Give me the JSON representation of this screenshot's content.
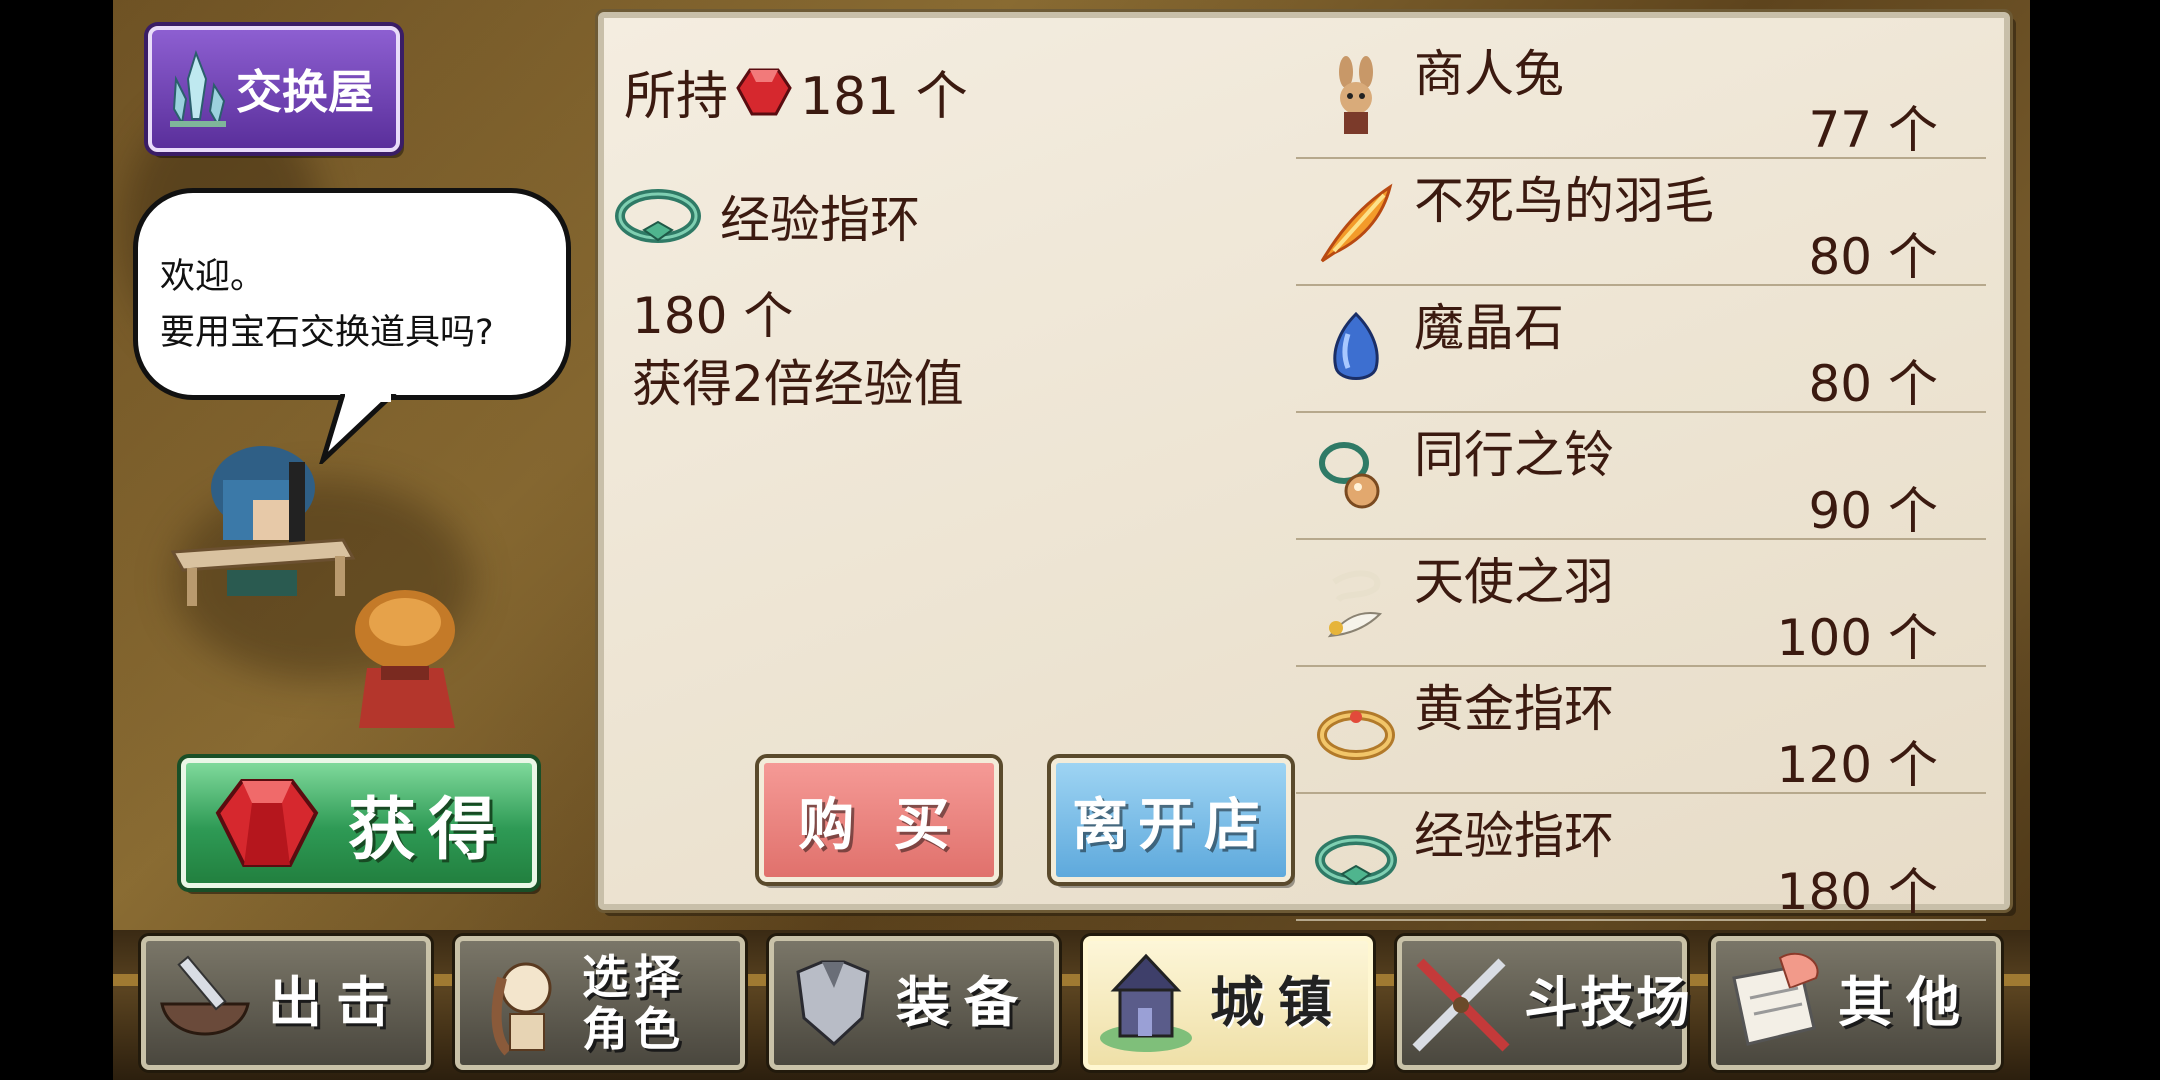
{
  "shop": {
    "title": "交换屋"
  },
  "speech": {
    "line1": "欢迎。",
    "line2": "要用宝石交换道具吗?"
  },
  "obtain_button": {
    "label": "获得"
  },
  "panel": {
    "owned_prefix": "所持",
    "owned_count": "181 个",
    "selected_item": {
      "name": "经验指环",
      "price": "180 个",
      "description": "获得2倍经验值"
    },
    "buy_label": "购 买",
    "leave_label": "离开店"
  },
  "items": [
    {
      "name": "商人兔",
      "price": "77 个",
      "icon": "rabbit-icon"
    },
    {
      "name": "不死鸟的羽毛",
      "price": "80 个",
      "icon": "phoenix-feather-icon"
    },
    {
      "name": "魔晶石",
      "price": "80 个",
      "icon": "blue-crystal-icon"
    },
    {
      "name": "同行之铃",
      "price": "90 个",
      "icon": "bell-icon"
    },
    {
      "name": "天使之羽",
      "price": "100 个",
      "icon": "angel-feather-icon"
    },
    {
      "name": "黄金指环",
      "price": "120 个",
      "icon": "gold-ring-icon"
    },
    {
      "name": "经验指环",
      "price": "180 个",
      "icon": "exp-ring-icon"
    }
  ],
  "nav": [
    {
      "label": "出击",
      "icon": "sword-bowl-icon"
    },
    {
      "label": "选择\n角色",
      "icon": "character-icon"
    },
    {
      "label": "装备",
      "icon": "armor-icon"
    },
    {
      "label": "城镇",
      "icon": "town-icon",
      "active": true
    },
    {
      "label": "斗技场",
      "icon": "crossed-swords-icon"
    },
    {
      "label": "其他",
      "icon": "scroll-icon"
    }
  ],
  "colors": {
    "text": "#3b1a10",
    "buy": "#e0716c",
    "leave": "#5ea9dc",
    "obtain": "#2e9a55",
    "title": "#5a2f9b"
  }
}
